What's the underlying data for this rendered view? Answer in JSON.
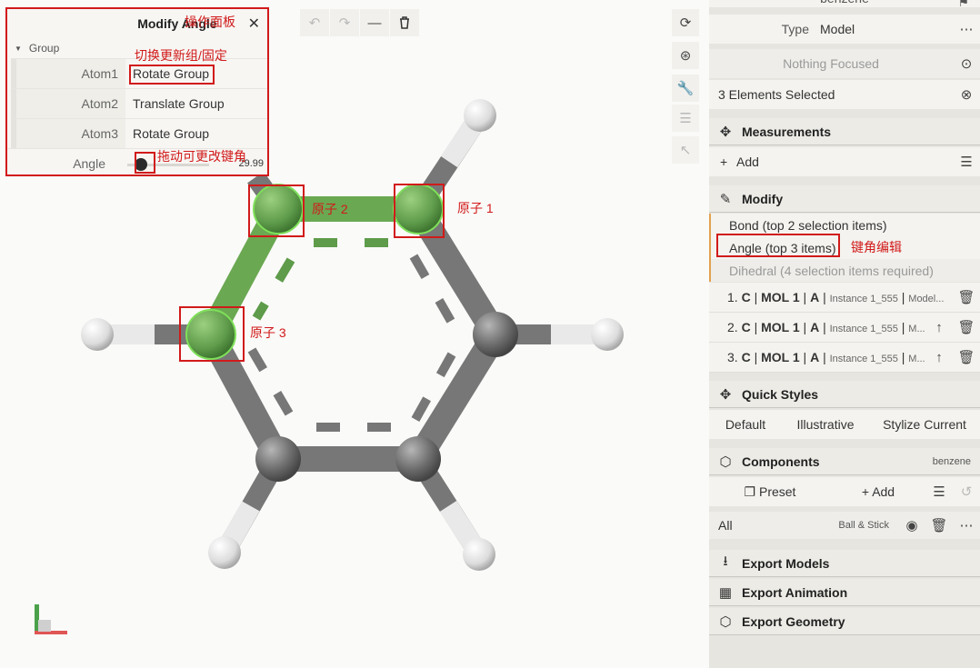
{
  "viewport": {
    "toolbar_top": {
      "undo_icon": "↶",
      "redo_icon": "↷",
      "minimize_icon": "—",
      "delete_icon": "🗑"
    }
  },
  "angle_panel": {
    "title": "Modify Angle",
    "title_annotation": "操作面板",
    "close": "✕",
    "group_label": "Group",
    "group_annotation": "切换更新组/固定",
    "rows": [
      {
        "label": "Atom1",
        "value": "Rotate Group"
      },
      {
        "label": "Atom2",
        "value": "Translate Group"
      },
      {
        "label": "Atom3",
        "value": "Rotate Group"
      }
    ],
    "angle_label": "Angle",
    "angle_value": "29.99",
    "slider_annotation": "拖动可更改键角"
  },
  "annotations": {
    "atom1": "原子 1",
    "atom2": "原子 2",
    "atom3": "原子 3",
    "angle_edit": "键角编辑"
  },
  "side": {
    "top_value": "benzene",
    "type_label": "Type",
    "type_value": "Model",
    "nothing_focused": "Nothing Focused",
    "selected": "3 Elements Selected",
    "measurements": "Measurements",
    "add": "Add",
    "modify": "Modify",
    "modify_items": [
      "Bond (top 2 selection items)",
      "Angle (top 3 items)",
      "Dihedral (4 selection items required)"
    ],
    "selection_items": [
      {
        "num": "1.",
        "atom": "C",
        "mol": "MOL 1",
        "chain": "A",
        "instance": "Instance 1_555",
        "rest": "Model..."
      },
      {
        "num": "2.",
        "atom": "C",
        "mol": "MOL 1",
        "chain": "A",
        "instance": "Instance 1_555",
        "rest": "M..."
      },
      {
        "num": "3.",
        "atom": "C",
        "mol": "MOL 1",
        "chain": "A",
        "instance": "Instance 1_555",
        "rest": "M..."
      }
    ],
    "quick_styles": "Quick Styles",
    "styles": [
      "Default",
      "Illustrative",
      "Stylize Current"
    ],
    "components": "Components",
    "components_value": "benzene",
    "preset": "Preset",
    "all_label": "All",
    "all_repr": "Ball & Stick",
    "export_models": "Export Models",
    "export_animation": "Export Animation",
    "export_geometry": "Export Geometry"
  }
}
